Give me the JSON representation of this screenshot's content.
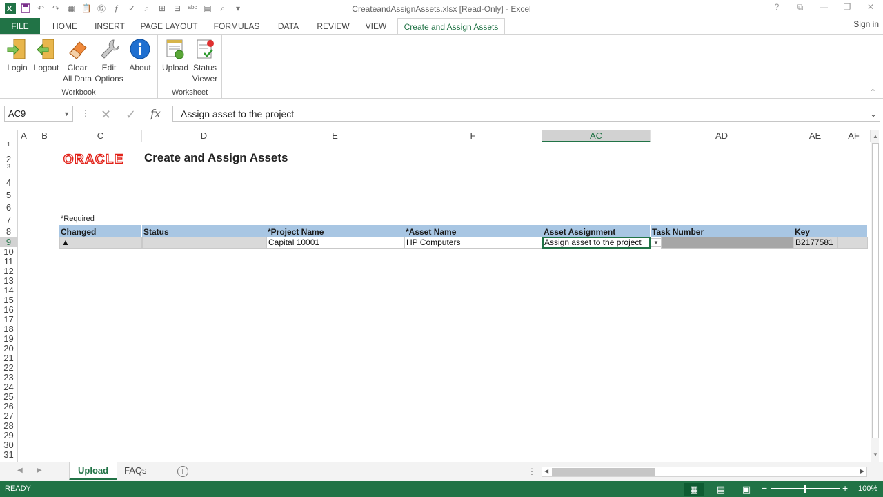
{
  "window": {
    "title": "CreateandAssignAssets.xlsx  [Read-Only] - Excel",
    "help": "?",
    "signin": "Sign in"
  },
  "tabs": [
    "FILE",
    "HOME",
    "INSERT",
    "PAGE LAYOUT",
    "FORMULAS",
    "DATA",
    "REVIEW",
    "VIEW",
    "Create and Assign Assets"
  ],
  "ribbon": {
    "groups": [
      {
        "label": "Workbook",
        "buttons": [
          {
            "label1": "Login",
            "label2": ""
          },
          {
            "label1": "Logout",
            "label2": ""
          },
          {
            "label1": "Clear",
            "label2": "All Data"
          },
          {
            "label1": "Edit",
            "label2": "Options"
          },
          {
            "label1": "About",
            "label2": ""
          }
        ]
      },
      {
        "label": "Worksheet",
        "buttons": [
          {
            "label1": "Upload",
            "label2": ""
          },
          {
            "label1": "Status",
            "label2": "Viewer"
          }
        ]
      }
    ]
  },
  "formula_bar": {
    "name_box": "AC9",
    "fx": "fx",
    "value": "Assign asset to the project"
  },
  "columns": [
    "A",
    "B",
    "C",
    "D",
    "E",
    "F",
    "AC",
    "AD",
    "AE",
    "AF"
  ],
  "rows": [
    "1",
    "2",
    "3",
    "4",
    "5",
    "6",
    "7",
    "8",
    "9",
    "10",
    "11",
    "12",
    "13",
    "14",
    "15",
    "16",
    "17",
    "18",
    "19",
    "20",
    "21",
    "22",
    "23",
    "24",
    "25",
    "26",
    "27",
    "28",
    "29",
    "30",
    "31"
  ],
  "sheet": {
    "logo_text": "ORACLE",
    "title": "Create and Assign Assets",
    "required_note": "*Required",
    "headers": [
      "Changed",
      "Status",
      "*Project Name",
      "*Asset Name",
      "Asset Assignment",
      "Task Number",
      "Key"
    ],
    "row9": {
      "changed": "▲",
      "status": "",
      "project_name": "Capital 10001",
      "asset_name": "HP Computers",
      "asset_assignment": "Assign asset to the project",
      "task_number": "",
      "key": "B2177581"
    }
  },
  "sheet_tabs": [
    "Upload",
    "FAQs"
  ],
  "status": {
    "ready": "READY",
    "zoom": "100%"
  },
  "colors": {
    "excel_green": "#217346",
    "header_blue": "#a8c6e3",
    "oracle_red": "#e2231a"
  }
}
